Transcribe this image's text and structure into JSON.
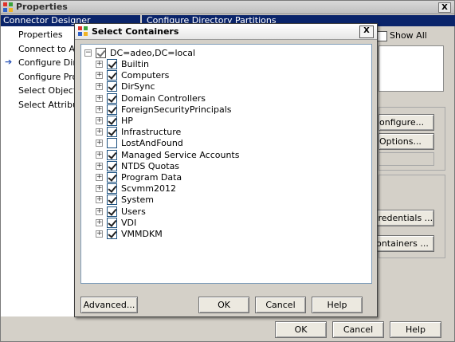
{
  "outer": {
    "title": "Properties",
    "close_glyph": "X",
    "nav_header": "Connector Designer",
    "nav_items": [
      "Properties",
      "Connect to Active",
      "Configure Directo",
      "Configure Provisio",
      "Select Object Typ",
      "Select Attributes"
    ],
    "selected_nav_index": 2,
    "right_header": "Configure Directory Partitions",
    "show_all_label": "Show All",
    "bg_buttons": {
      "configure": "onfigure...",
      "options": "Options...",
      "credentials": "Credentials ...",
      "containers": "ontainers ..."
    },
    "footer": {
      "ok": "OK",
      "cancel": "Cancel",
      "help": "Help"
    }
  },
  "dialog": {
    "title": "Select Containers",
    "close_glyph": "X",
    "root": {
      "label": "DC=adeo,DC=local",
      "state": "partial"
    },
    "containers": [
      {
        "label": "Builtin",
        "checked": true
      },
      {
        "label": "Computers",
        "checked": true
      },
      {
        "label": "DirSync",
        "checked": true
      },
      {
        "label": "Domain Controllers",
        "checked": true
      },
      {
        "label": "ForeignSecurityPrincipals",
        "checked": true
      },
      {
        "label": "HP",
        "checked": true
      },
      {
        "label": "Infrastructure",
        "checked": true
      },
      {
        "label": "LostAndFound",
        "checked": false
      },
      {
        "label": "Managed Service Accounts",
        "checked": true
      },
      {
        "label": "NTDS Quotas",
        "checked": true
      },
      {
        "label": "Program Data",
        "checked": true
      },
      {
        "label": "Scvmm2012",
        "checked": true
      },
      {
        "label": "System",
        "checked": true
      },
      {
        "label": "Users",
        "checked": true
      },
      {
        "label": "VDI",
        "checked": true
      },
      {
        "label": "VMMDKM",
        "checked": true
      }
    ],
    "buttons": {
      "advanced": "Advanced...",
      "ok": "OK",
      "cancel": "Cancel",
      "help": "Help"
    }
  },
  "colors": {
    "selection": "#0a246a",
    "face": "#d4d0c8",
    "arrow": "#2a54b8"
  }
}
